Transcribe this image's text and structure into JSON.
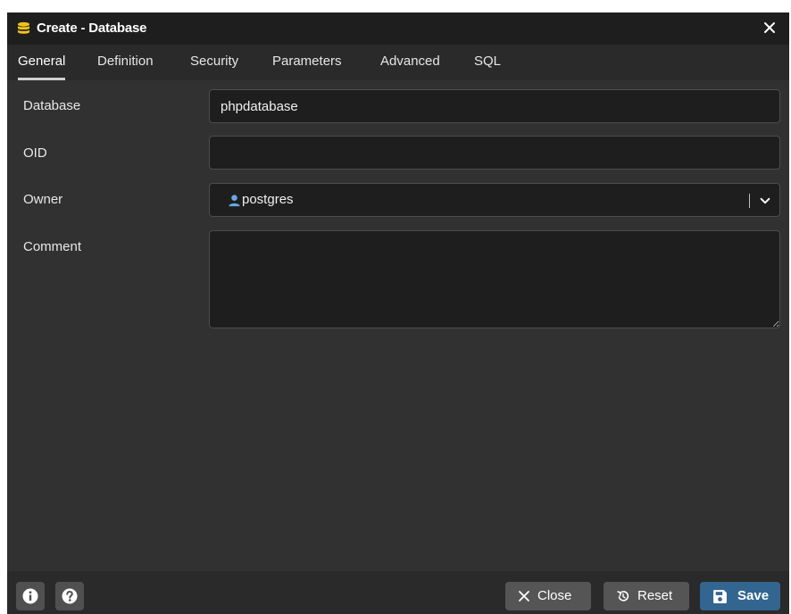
{
  "window": {
    "title": "Create - Database",
    "title_icon": "database-icon",
    "close_icon": "close-icon"
  },
  "tabs": [
    {
      "label": "General",
      "active": true
    },
    {
      "label": "Definition",
      "active": false
    },
    {
      "label": "Security",
      "active": false
    },
    {
      "label": "Parameters",
      "active": false
    },
    {
      "label": "Advanced",
      "active": false
    },
    {
      "label": "SQL",
      "active": false
    }
  ],
  "form": {
    "database": {
      "label": "Database",
      "value": "phpdatabase"
    },
    "oid": {
      "label": "OID",
      "value": ""
    },
    "owner": {
      "label": "Owner",
      "value": "postgres",
      "icon": "user-icon"
    },
    "comment": {
      "label": "Comment",
      "value": ""
    }
  },
  "footer": {
    "info_icon": "info-icon",
    "help_icon": "help-icon",
    "close_label": "Close",
    "reset_label": "Reset",
    "save_label": "Save"
  },
  "colors": {
    "background": "#313131",
    "titlebar": "#1e1e1e",
    "input_bg": "#1e1e1e",
    "button_secondary": "#555555",
    "button_primary": "#326690",
    "db_icon": "#f1c21b",
    "user_icon": "#6aa6e8"
  }
}
